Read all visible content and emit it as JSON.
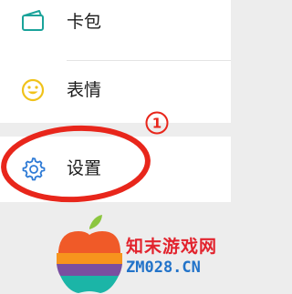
{
  "menu": {
    "items": [
      {
        "label": "卡包",
        "icon": "card-wallet-icon"
      },
      {
        "label": "表情",
        "icon": "smiley-icon"
      },
      {
        "label": "设置",
        "icon": "gear-icon"
      }
    ]
  },
  "annotation": {
    "step_number": "①",
    "color": "#e8261b"
  },
  "watermark": {
    "name": "知末游戏网",
    "domain": "ZM028.CN"
  },
  "colors": {
    "icon_teal": "#1aa39a",
    "icon_yellow": "#f0c21a",
    "gear_blue": "#2f7bd6"
  }
}
